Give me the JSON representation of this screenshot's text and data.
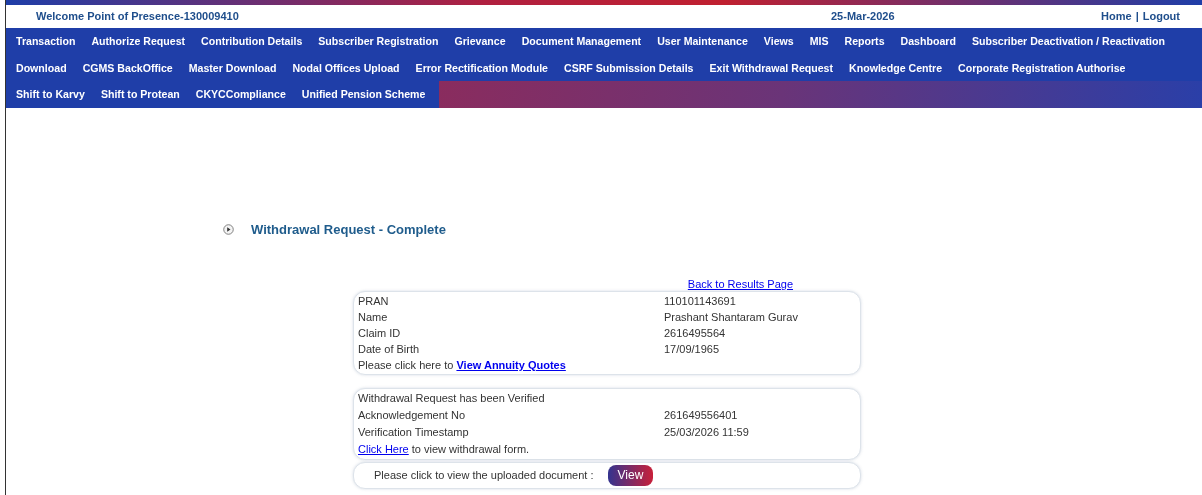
{
  "header": {
    "welcome": "Welcome Point of Presence-130009410",
    "date": "25-Mar-2026",
    "links": [
      "Home",
      "Logout"
    ],
    "separator": "|"
  },
  "menu_rows": [
    [
      "Transaction",
      "Authorize Request",
      "Contribution Details",
      "Subscriber Registration",
      "Grievance",
      "Document Management",
      "User Maintenance",
      "Views",
      "MIS",
      "Reports",
      "Dashboard",
      "Subscriber Deactivation / Reactivation"
    ],
    [
      "Download",
      "CGMS BackOffice",
      "Master Download",
      "Nodal Offices Upload",
      "Error Rectification Module",
      "CSRF Submission Details",
      "Exit Withdrawal Request",
      "Knowledge Centre",
      "Corporate Registration Authorise"
    ],
    [
      "Shift to Karvy",
      "Shift to Protean",
      "CKYCCompliance",
      "Unified Pension Scheme"
    ]
  ],
  "page_title": "Withdrawal Request - Complete",
  "back_link": "Back to Results Page",
  "subscriber_details": [
    {
      "label": "PRAN",
      "value": "110101143691"
    },
    {
      "label": "Name",
      "value": "Prashant Shantaram Gurav"
    },
    {
      "label": "Claim ID",
      "value": "2616495564"
    },
    {
      "label": "Date of Birth",
      "value": "17/09/1965"
    }
  ],
  "annuity_prompt": {
    "text": "Please click here to ",
    "link": "View Annuity Quotes"
  },
  "verification": {
    "status": "Withdrawal Request has been Verified",
    "fields": [
      {
        "label": "Acknowledgement No",
        "value": "261649556401"
      },
      {
        "label": "Verification Timestamp",
        "value": "25/03/2026 11:59"
      }
    ],
    "form_prompt": {
      "link": "Click Here",
      "text": " to view withdrawal form."
    }
  },
  "document": {
    "prompt": "Please click to view the uploaded document :",
    "button": "View"
  }
}
